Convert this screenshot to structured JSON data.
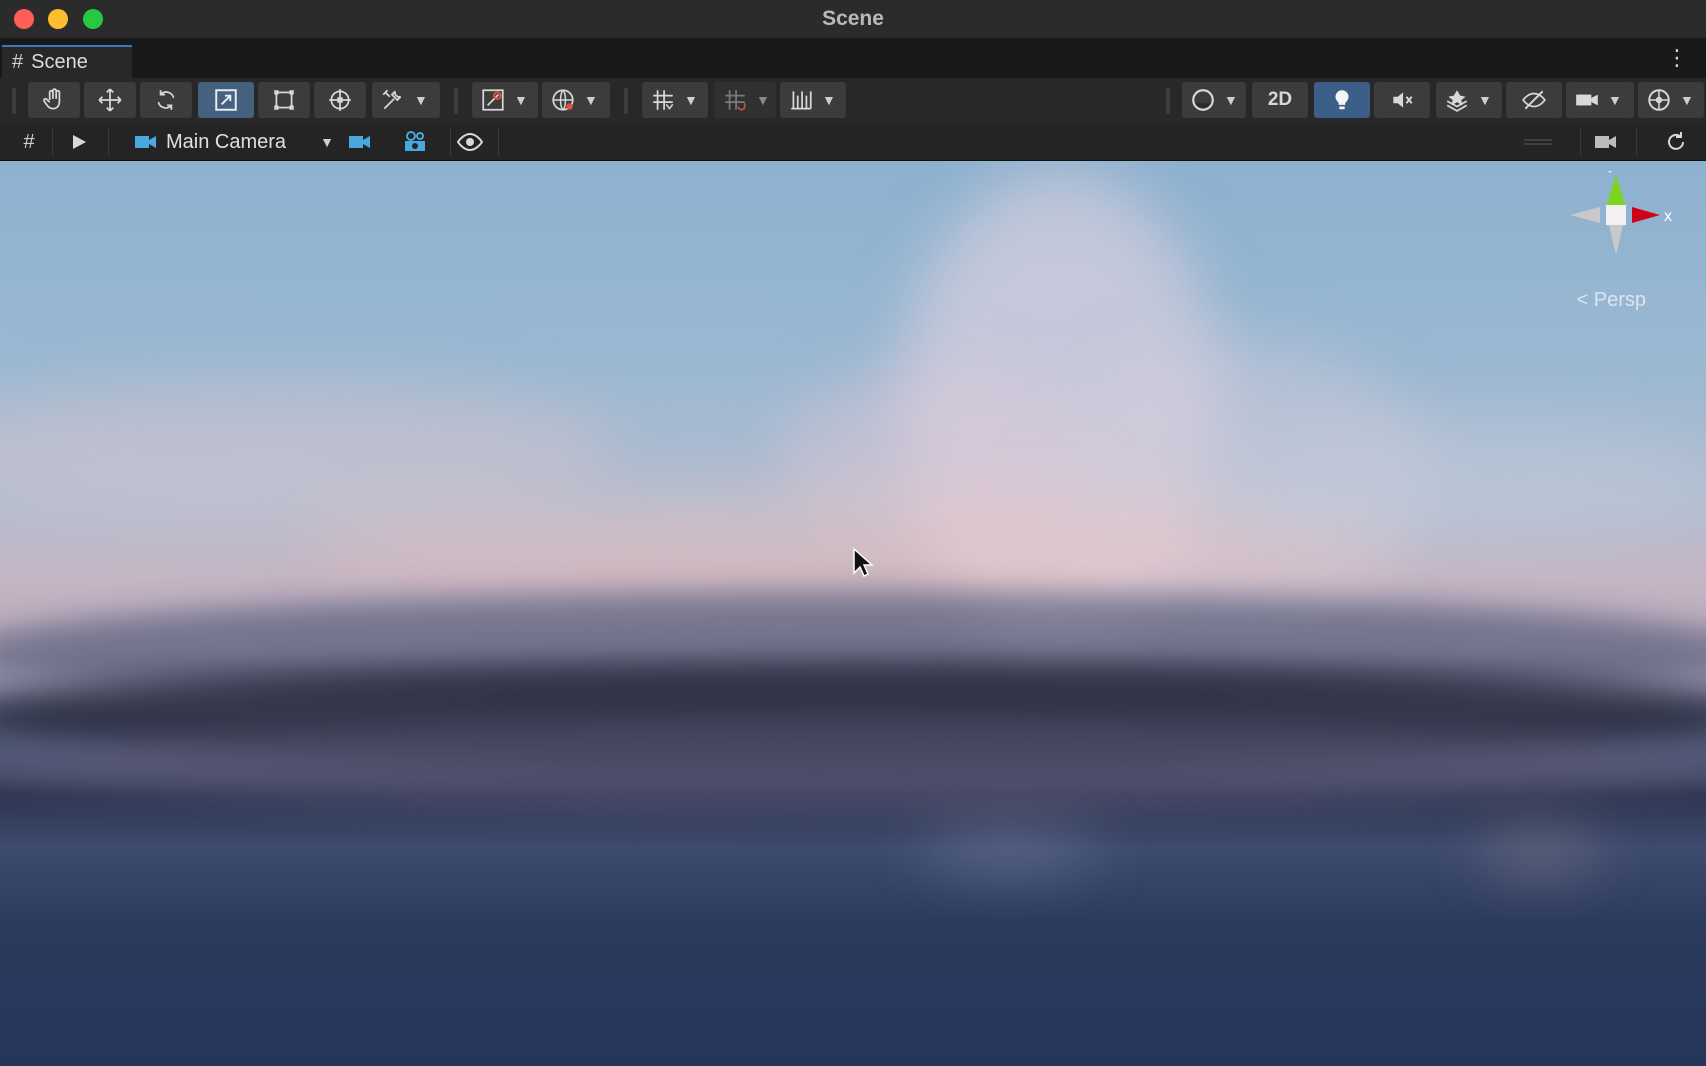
{
  "window": {
    "title": "Scene"
  },
  "tab": {
    "label": "Scene",
    "icon": "grid-icon"
  },
  "toolbar": {
    "tools": [
      "hand-tool",
      "move-tool",
      "rotate-tool",
      "scale-tool",
      "rect-tool",
      "transform-tool",
      "custom-editor-tool"
    ],
    "active_tool": "scale-tool",
    "label_2d": "2D",
    "lighting_active": true
  },
  "camera_bar": {
    "camera_label": "Main Camera"
  },
  "viewport": {
    "gizmo_y": "y",
    "gizmo_x": "x",
    "projection_label": "Persp"
  },
  "colors": {
    "accent": "#3a79bb",
    "active_button": "#46607f",
    "gizmo_y": "#7ed321",
    "gizmo_x": "#d0021b"
  }
}
